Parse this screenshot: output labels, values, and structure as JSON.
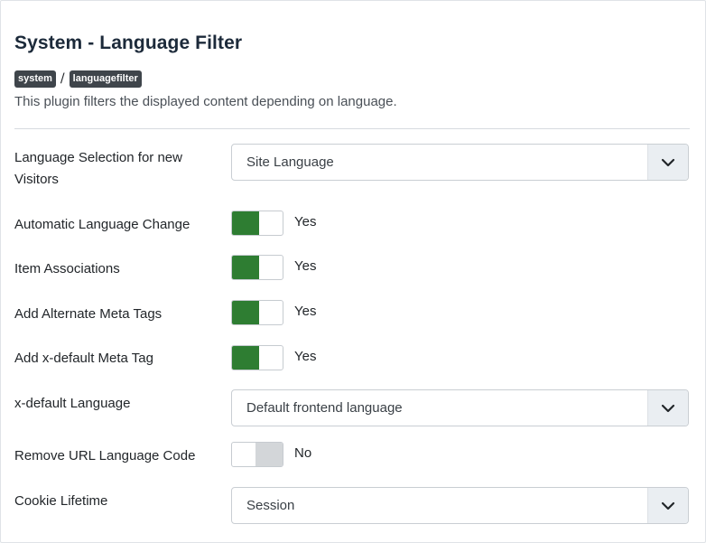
{
  "plugin": {
    "title": "System - Language Filter",
    "tag_folder": "system",
    "tag_separator": "/",
    "tag_element": "languagefilter",
    "description": "This plugin filters the displayed content depending on language."
  },
  "fields": {
    "language_selection": {
      "label_line1": "Language Selection for new",
      "label_line2": "Visitors",
      "value": "Site Language"
    },
    "automatic_language_change": {
      "label": "Automatic Language Change",
      "value": "Yes",
      "on": true
    },
    "item_associations": {
      "label": "Item Associations",
      "value": "Yes",
      "on": true
    },
    "alternate_meta_tags": {
      "label": "Add Alternate Meta Tags",
      "value": "Yes",
      "on": true
    },
    "xdefault_meta_tag": {
      "label": "Add x-default Meta Tag",
      "value": "Yes",
      "on": true
    },
    "xdefault_language": {
      "label": "x-default Language",
      "value": "Default frontend language"
    },
    "remove_url_language_code": {
      "label": "Remove URL Language Code",
      "value": "No",
      "on": false
    },
    "cookie_lifetime": {
      "label": "Cookie Lifetime",
      "value": "Session"
    }
  },
  "colors": {
    "switch_on": "#2e7d32",
    "switch_off": "#d3d6d9",
    "tag_background": "#3f454b"
  },
  "icons": {
    "select_arrow": "chevron-down-icon"
  }
}
